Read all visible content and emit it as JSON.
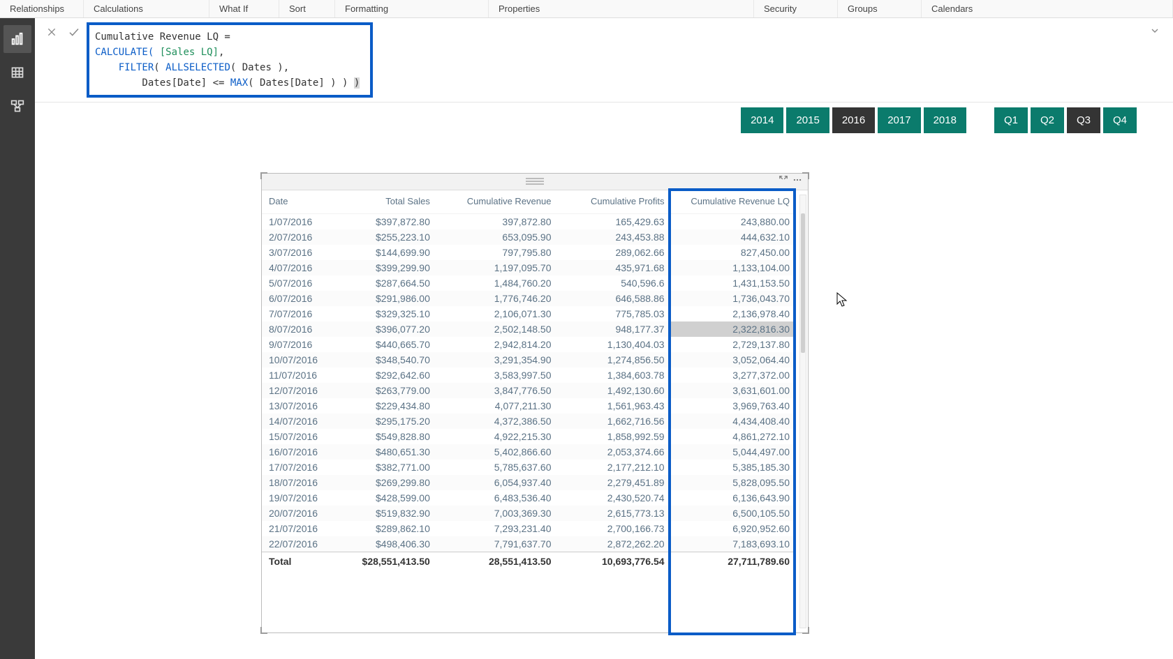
{
  "ribbon": {
    "tabs": [
      "Relationships",
      "Calculations",
      "What If",
      "Sort",
      "Formatting",
      "Properties",
      "Security",
      "Groups",
      "Calendars"
    ]
  },
  "rail": {
    "report": "Report view",
    "data": "Data view",
    "model": "Model view"
  },
  "formula": {
    "line1a": "Cumulative Revenue LQ = ",
    "line2a": "CALCULATE(",
    "line2b": " [Sales LQ]",
    "line2c": ",",
    "line3a": "    ",
    "line3b": "FILTER",
    "line3c": "( ",
    "line3d": "ALLSELECTED",
    "line3e": "( Dates ),",
    "line4a": "        Dates[Date] <= ",
    "line4b": "MAX",
    "line4c": "( Dates[Date] ) ) ",
    "line4d": ")"
  },
  "slicers": {
    "years": [
      {
        "label": "2014",
        "dim": false
      },
      {
        "label": "2015",
        "dim": false
      },
      {
        "label": "2016",
        "dim": true
      },
      {
        "label": "2017",
        "dim": false
      },
      {
        "label": "2018",
        "dim": false
      }
    ],
    "quarters": [
      {
        "label": "Q1",
        "dim": false
      },
      {
        "label": "Q2",
        "dim": false
      },
      {
        "label": "Q3",
        "dim": true
      },
      {
        "label": "Q4",
        "dim": false
      }
    ]
  },
  "table": {
    "columns": [
      "Date",
      "Total Sales",
      "Cumulative Revenue",
      "Cumulative Profits",
      "Cumulative Revenue LQ"
    ],
    "rows": [
      {
        "date": "1/07/2016",
        "c2": "$397,872.80",
        "c3": "397,872.80",
        "c4": "165,429.63",
        "c5": "243,880.00"
      },
      {
        "date": "2/07/2016",
        "c2": "$255,223.10",
        "c3": "653,095.90",
        "c4": "243,453.88",
        "c5": "444,632.10"
      },
      {
        "date": "3/07/2016",
        "c2": "$144,699.90",
        "c3": "797,795.80",
        "c4": "289,062.66",
        "c5": "827,450.00"
      },
      {
        "date": "4/07/2016",
        "c2": "$399,299.90",
        "c3": "1,197,095.70",
        "c4": "435,971.68",
        "c5": "1,133,104.00"
      },
      {
        "date": "5/07/2016",
        "c2": "$287,664.50",
        "c3": "1,484,760.20",
        "c4": "540,596.6",
        "c5": "1,431,153.50"
      },
      {
        "date": "6/07/2016",
        "c2": "$291,986.00",
        "c3": "1,776,746.20",
        "c4": "646,588.86",
        "c5": "1,736,043.70"
      },
      {
        "date": "7/07/2016",
        "c2": "$329,325.10",
        "c3": "2,106,071.30",
        "c4": "775,785.03",
        "c5": "2,136,978.40"
      },
      {
        "date": "8/07/2016",
        "c2": "$396,077.20",
        "c3": "2,502,148.50",
        "c4": "948,177.37",
        "c5": "2,322,816.30",
        "hl": true
      },
      {
        "date": "9/07/2016",
        "c2": "$440,665.70",
        "c3": "2,942,814.20",
        "c4": "1,130,404.03",
        "c5": "2,729,137.80"
      },
      {
        "date": "10/07/2016",
        "c2": "$348,540.70",
        "c3": "3,291,354.90",
        "c4": "1,274,856.50",
        "c5": "3,052,064.40"
      },
      {
        "date": "11/07/2016",
        "c2": "$292,642.60",
        "c3": "3,583,997.50",
        "c4": "1,384,603.78",
        "c5": "3,277,372.00"
      },
      {
        "date": "12/07/2016",
        "c2": "$263,779.00",
        "c3": "3,847,776.50",
        "c4": "1,492,130.60",
        "c5": "3,631,601.00"
      },
      {
        "date": "13/07/2016",
        "c2": "$229,434.80",
        "c3": "4,077,211.30",
        "c4": "1,561,963.43",
        "c5": "3,969,763.40"
      },
      {
        "date": "14/07/2016",
        "c2": "$295,175.20",
        "c3": "4,372,386.50",
        "c4": "1,662,716.56",
        "c5": "4,434,408.40"
      },
      {
        "date": "15/07/2016",
        "c2": "$549,828.80",
        "c3": "4,922,215.30",
        "c4": "1,858,992.59",
        "c5": "4,861,272.10"
      },
      {
        "date": "16/07/2016",
        "c2": "$480,651.30",
        "c3": "5,402,866.60",
        "c4": "2,053,374.66",
        "c5": "5,044,497.00"
      },
      {
        "date": "17/07/2016",
        "c2": "$382,771.00",
        "c3": "5,785,637.60",
        "c4": "2,177,212.10",
        "c5": "5,385,185.30"
      },
      {
        "date": "18/07/2016",
        "c2": "$269,299.80",
        "c3": "6,054,937.40",
        "c4": "2,279,451.89",
        "c5": "5,828,095.50"
      },
      {
        "date": "19/07/2016",
        "c2": "$428,599.00",
        "c3": "6,483,536.40",
        "c4": "2,430,520.74",
        "c5": "6,136,643.90"
      },
      {
        "date": "20/07/2016",
        "c2": "$519,832.90",
        "c3": "7,003,369.30",
        "c4": "2,615,773.13",
        "c5": "6,500,105.50"
      },
      {
        "date": "21/07/2016",
        "c2": "$289,862.10",
        "c3": "7,293,231.40",
        "c4": "2,700,166.73",
        "c5": "6,920,952.60"
      },
      {
        "date": "22/07/2016",
        "c2": "$498,406.30",
        "c3": "7,791,637.70",
        "c4": "2,872,262.20",
        "c5": "7,183,693.10"
      }
    ],
    "total": {
      "label": "Total",
      "c2": "$28,551,413.50",
      "c3": "28,551,413.50",
      "c4": "10,693,776.54",
      "c5": "27,711,789.60"
    }
  }
}
